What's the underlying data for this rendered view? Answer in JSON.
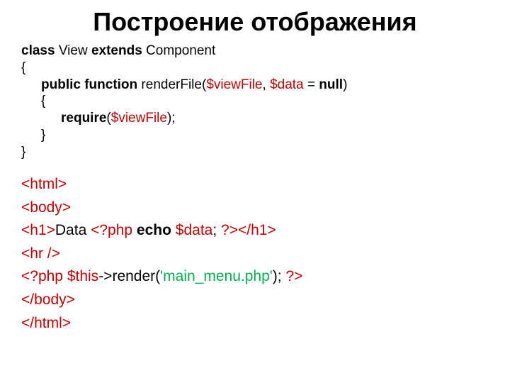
{
  "title": "Построение отображения",
  "code": {
    "l1_kw1": "class",
    "l1_name": " View ",
    "l1_kw2": "extends",
    "l1_comp": " Component",
    "l2": "{",
    "l3_kw": "public function",
    "l3_name": " renderFile(",
    "l3_var1": "$viewFile",
    "l3_mid": ", ",
    "l3_var2": "$data",
    "l3_eq": " = ",
    "l3_null": "null",
    "l3_end": ")",
    "l4": "{",
    "l5_kw": "require",
    "l5_open": "(",
    "l5_var": "$viewFile",
    "l5_end": ");",
    "l6": "}",
    "l7": "}"
  },
  "tpl": {
    "t1": "<html>",
    "t2": "<body>",
    "t3_open": "<h1>",
    "t3_text": "Data ",
    "t3_php_open": "<?php ",
    "t3_echo": "echo",
    "t3_sp": " ",
    "t3_var": "$data",
    "t3_semi": "; ",
    "t3_php_close": "?>",
    "t3_close": "</h1>",
    "t4": "<hr />",
    "t5_php_open": "<?php ",
    "t5_this_var": "$this",
    "t5_call": "->render(",
    "t5_str": "'main_menu.php'",
    "t5_end": "); ",
    "t5_php_close": "?>",
    "t6": "</body>",
    "t7": "</html>"
  }
}
